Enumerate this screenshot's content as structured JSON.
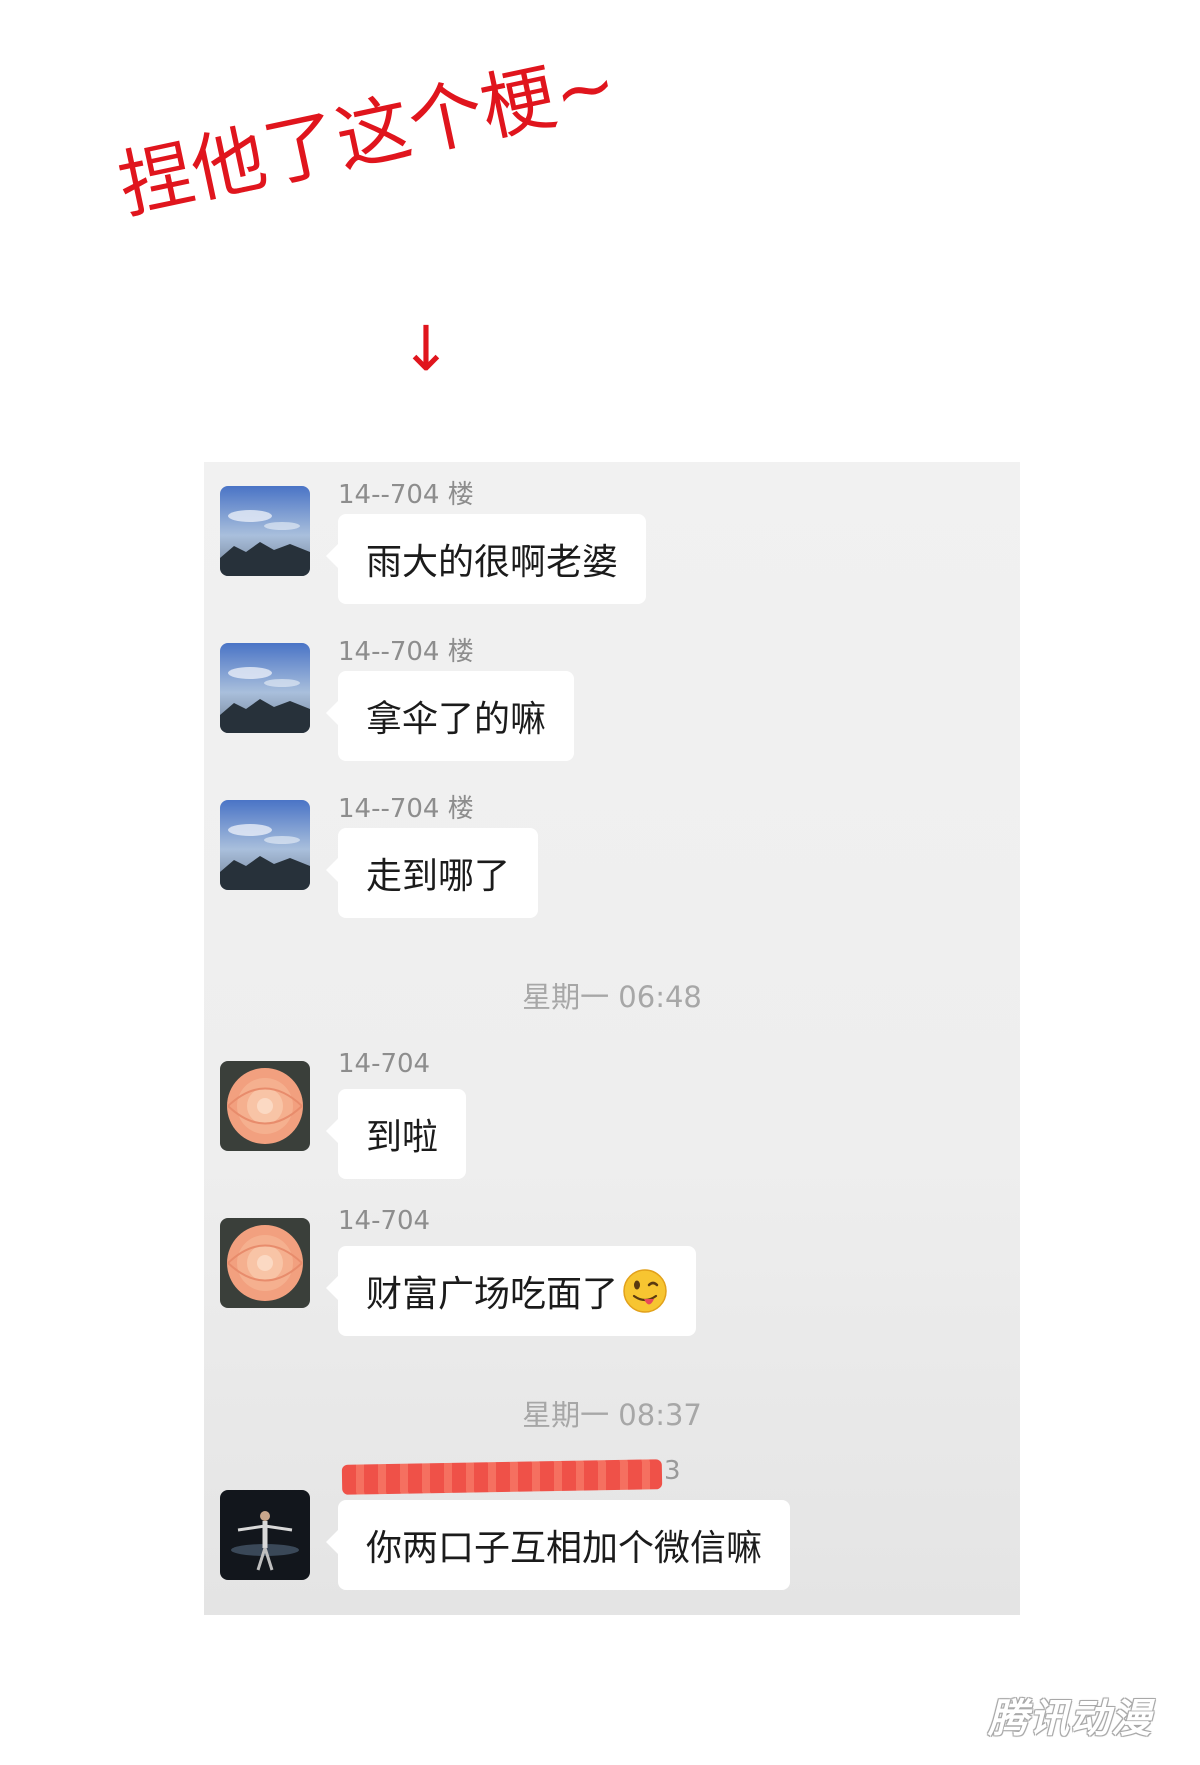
{
  "caption": "捏他了这个梗~",
  "arrow": "↓",
  "messages": [
    {
      "sender": "14--704 楼",
      "text": "雨大的很啊老婆",
      "avatar": "sky-mountain-avatar"
    },
    {
      "sender": "14--704 楼",
      "text": "拿伞了的嘛",
      "avatar": "sky-mountain-avatar"
    },
    {
      "sender": "14--704 楼",
      "text": "走到哪了",
      "avatar": "sky-mountain-avatar"
    },
    {
      "sender": "14-704",
      "text": "到啦",
      "avatar": "flower-avatar"
    },
    {
      "sender": "14-704",
      "text": "财富广场吃面了",
      "avatar": "flower-avatar",
      "emoji": "winking-tongue-emoji"
    },
    {
      "sender": "3",
      "text": "你两口子互相加个微信嘛",
      "avatar": "dancer-avatar"
    }
  ],
  "timestamps": [
    "星期一 06:48",
    "星期一 08:37"
  ],
  "watermark": "腾讯动漫",
  "colors": {
    "caption": "#e0151d",
    "redaction": "#ef5148"
  }
}
